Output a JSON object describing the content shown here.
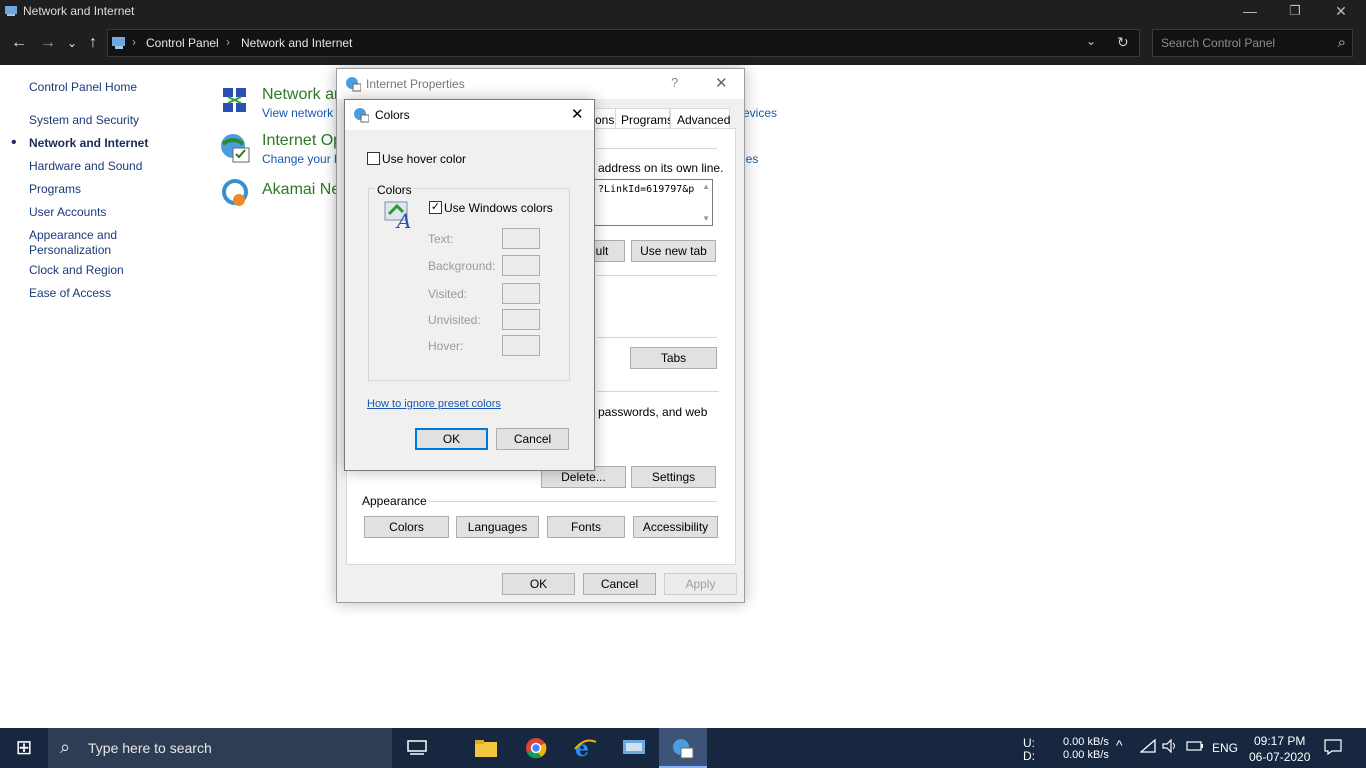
{
  "window": {
    "title": "Network and Internet",
    "minimize_glyph": "—",
    "restore_glyph": "❐",
    "close_glyph": "✕"
  },
  "address_bar": {
    "back_glyph": "←",
    "forward_glyph": "→",
    "recent_glyph": "⌄",
    "up_glyph": "↑",
    "crumbs": [
      "Control Panel",
      "Network and Internet"
    ],
    "sep_glyph": "›",
    "dropdown_glyph": "⌄",
    "refresh_glyph": "↻",
    "search_placeholder": "Search Control Panel",
    "search_icon": "⌕"
  },
  "left_nav": {
    "home": "Control Panel Home",
    "items": [
      "System and Security",
      "Network and Internet",
      "Hardware and Sound",
      "Programs",
      "User Accounts",
      "Appearance and",
      "Personalization",
      "Clock and Region",
      "Ease of Access"
    ],
    "active_bullet": "•"
  },
  "categories": {
    "network": {
      "title": "Network ar",
      "sub": "View network",
      "sub_right": "evices"
    },
    "internet": {
      "title": "Internet Op",
      "sub": "Change your h",
      "sub_right": "ies"
    },
    "akamai": {
      "title": "Akamai Ne"
    }
  },
  "internet_properties": {
    "title": "Internet Properties",
    "help_glyph": "?",
    "close_glyph": "✕",
    "tabs": [
      "ons",
      "Programs",
      "Advanced"
    ],
    "homepage_text": "address on its own line.",
    "url_text": "?LinkId=619797&p",
    "btn_default": "ult",
    "btn_new_tab": "Use new tab",
    "btn_tabs": "Tabs",
    "browsing_text": "passwords, and web",
    "btn_delete": "Delete...",
    "btn_settings": "Settings",
    "appearance_label": "Appearance",
    "btn_colors": "Colors",
    "btn_languages": "Languages",
    "btn_fonts": "Fonts",
    "btn_accessibility": "Accessibility",
    "btn_ok": "OK",
    "btn_cancel": "Cancel",
    "btn_apply": "Apply"
  },
  "colors_dialog": {
    "title": "Colors",
    "close_glyph": "✕",
    "hover_checkbox": {
      "label": "Use hover color",
      "checked": false
    },
    "group_label": "Colors",
    "windows_colors": {
      "label": "Use Windows colors",
      "checked": true,
      "check_glyph": "✓"
    },
    "color_rows": [
      "Text:",
      "Background:",
      "Visited:",
      "Unvisited:",
      "Hover:"
    ],
    "link": "How to ignore preset colors",
    "btn_ok": "OK",
    "btn_cancel": "Cancel"
  },
  "taskbar": {
    "start_glyph": "⊞",
    "search_placeholder": "Type here to search",
    "search_icon": "⌕",
    "tray": {
      "upload_label": "U:",
      "download_label": "D:",
      "upload_speed": "0.00 kB/s",
      "download_speed": "0.00 kB/s",
      "language": "ENG",
      "time": "09:17 PM",
      "date": "06-07-2020"
    }
  },
  "colors": {
    "accent": "#0078d7",
    "link": "#1a57b0",
    "category_green": "#2a7a25",
    "titlebar": "#1f1f1f",
    "taskbar": "#16273f"
  }
}
